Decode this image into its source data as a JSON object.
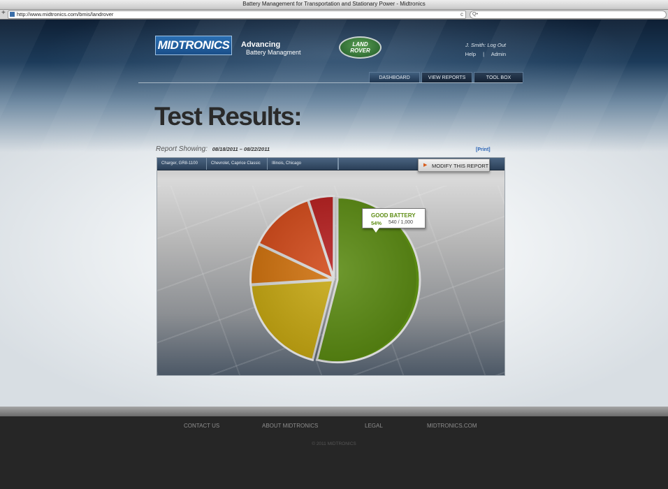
{
  "browser": {
    "window_title": "Battery Management for Transportation and Stationary Power - Midtronics",
    "url": "http://www.midtronics.com/bmis/landrover",
    "new_tab_glyph": "+",
    "reload_glyph": "c",
    "search_glyph": "Q•"
  },
  "header": {
    "brand_logo_text": "MIDTRONICS",
    "tagline_line1": "Advancing",
    "tagline_line2": "Battery Managment",
    "partner_logo_line1": "LAND",
    "partner_logo_line2": "ROVER",
    "user_name": "J. Smith:",
    "logout_label": "Log Out",
    "help_label": "Help",
    "separator": "|",
    "admin_label": "Admin"
  },
  "nav": {
    "tabs": [
      {
        "label": "DASHBOARD",
        "active": true
      },
      {
        "label": "VIEW REPORTS",
        "active": false
      },
      {
        "label": "TOOL BOX",
        "active": false
      }
    ]
  },
  "main": {
    "title": "Test Results:",
    "report_label": "Report Showing:",
    "date_range": "08/18/2011 – 08/22/2011",
    "print_label": "[Print]",
    "filters": [
      "Charger, GR8-1100",
      "Chevrolet, Caprice Classic",
      "Illinois, Chicago",
      ""
    ],
    "modify_label": "MODIFY THIS REPORT",
    "modify_icon": "play-arrow-icon",
    "callout": {
      "label": "GOOD BATTERY",
      "percent": "54%",
      "count": "540 / 1,000"
    }
  },
  "chart_data": {
    "type": "pie",
    "slices": [
      {
        "name": "GOOD BATTERY",
        "value": 54,
        "color": "#5a8a12"
      },
      {
        "value": 20,
        "color": "#c7a812"
      },
      {
        "value": 8,
        "color": "#d0720e"
      },
      {
        "value": 13,
        "color": "#d24a1a"
      },
      {
        "value": 5,
        "color": "#b51e1e"
      }
    ]
  },
  "footer": {
    "links": [
      "CONTACT US",
      "ABOUT MIDTRONICS",
      "LEGAL",
      "MIDTRONICS.COM"
    ],
    "copyright": "© 2011 MIDTRONICS"
  },
  "colors": {
    "accent": "#2a63b5",
    "good": "#5e8d14"
  }
}
